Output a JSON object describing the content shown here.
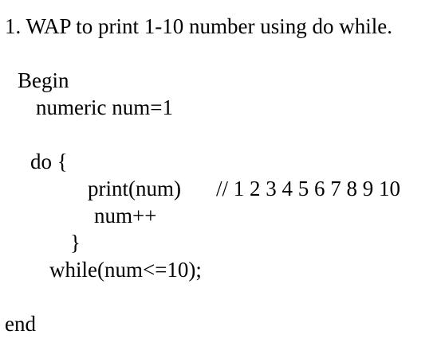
{
  "title": "1. WAP to print 1-10 number using do while.",
  "code": {
    "begin": "Begin",
    "declare": "numeric num=1",
    "do_open": "do {",
    "print": "print(num)",
    "comment": "// 1 2 3 4 5 6 7 8 9 10",
    "increment": "num++",
    "close_brace": "}",
    "while": "while(num<=10);",
    "end": "end"
  }
}
